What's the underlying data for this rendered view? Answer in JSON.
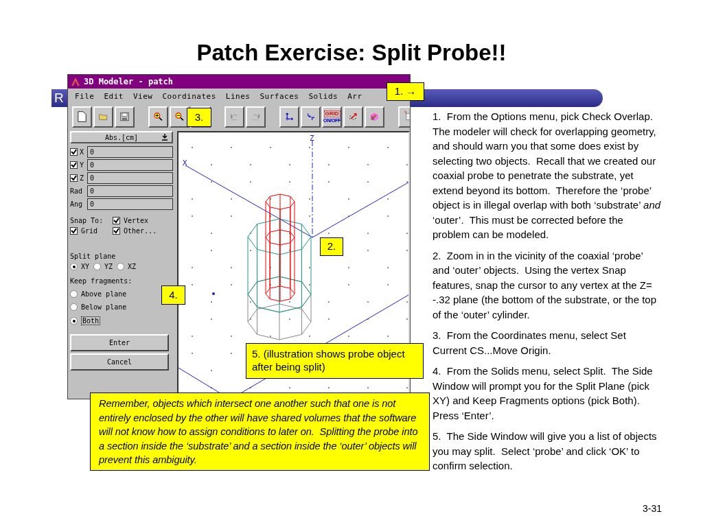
{
  "slide": {
    "title": "Patch Exercise: Split Probe!!",
    "page_number": "3-31"
  },
  "banner": {
    "text": "R"
  },
  "window": {
    "title": "3D Modeler - patch",
    "menu": [
      "File",
      "Edit",
      "View",
      "Coordinates",
      "Lines",
      "Surfaces",
      "Solids",
      "Arr"
    ],
    "grid_toggle": {
      "top": "GRID",
      "bottom": "ON/OFF"
    }
  },
  "side_panel": {
    "units": "Abs.[cm]",
    "coordinates": [
      {
        "kind": "checked",
        "label": "X",
        "checked": true,
        "value": "0"
      },
      {
        "kind": "checked",
        "label": "Y",
        "checked": true,
        "value": "0"
      },
      {
        "kind": "checked",
        "label": "Z",
        "checked": true,
        "value": "0"
      },
      {
        "kind": "plain",
        "label": "Rad",
        "value": "0"
      },
      {
        "kind": "plain",
        "label": "Ang",
        "value": "0"
      }
    ],
    "snap": {
      "label": "Snap To:",
      "options": [
        {
          "label": "Vertex",
          "checked": true
        },
        {
          "label": "Grid",
          "checked": true
        },
        {
          "label": "Other...",
          "checked": true
        }
      ]
    },
    "split_plane": {
      "label": "Split plane",
      "options": [
        {
          "label": "XY",
          "selected": true
        },
        {
          "label": "YZ",
          "selected": false
        },
        {
          "label": "XZ",
          "selected": false
        }
      ]
    },
    "keep_fragments": {
      "label": "Keep fragments:",
      "options": [
        {
          "label": "Above plane",
          "selected": false
        },
        {
          "label": "Below plane",
          "selected": false
        },
        {
          "label": "Both",
          "selected": true
        }
      ]
    },
    "buttons": [
      "Enter",
      "Cancel"
    ]
  },
  "canvas": {
    "axis_labels": [
      "Z",
      "X"
    ]
  },
  "callouts": [
    {
      "text": "1. →"
    },
    {
      "text": "3."
    },
    {
      "text": "2."
    },
    {
      "text": "4."
    },
    {
      "text": "5. (illustration shows probe object after being split)"
    }
  ],
  "note": "Remember, objects which intersect one another such that one is not entirely enclosed by the other will have shared volumes that the software will not know how to assign conditions to later on.  Splitting the probe into a section inside the ‘substrate’ and a section inside the ‘outer’ objects will prevent this ambiguity.",
  "steps": [
    "1.  From the Options menu, pick Check Overlap.  The modeler will check for overlapping geometry, and should warn you that some does exist by selecting two objects.  Recall that we created our coaxial probe to penetrate the substrate, yet extend beyond its bottom.  Therefore the ‘probe’ object is in illegal overlap with both ‘substrate’ *and* ‘outer’.  This must be corrected before the problem can be modeled.",
    "2.  Zoom in in the vicinity of the coaxial ‘probe’ and ‘outer’ objects.  Using the vertex Snap features, snap the cursor to any vertex at the Z= -.32 plane (the bottom of the substrate, or the top of the ‘outer’ cylinder.",
    "3.  From the Coordinates menu, select Set Current CS...Move Origin.",
    "4.  From the Solids menu, select Split.  The Side Window will prompt you for the Split Plane (pick XY) and Keep Fragments options (pick Both).  Press ‘Enter’.",
    "5.  The Side Window will give you a list of objects you may split.  Select ‘probe’ and click ‘OK’ to confirm selection."
  ]
}
